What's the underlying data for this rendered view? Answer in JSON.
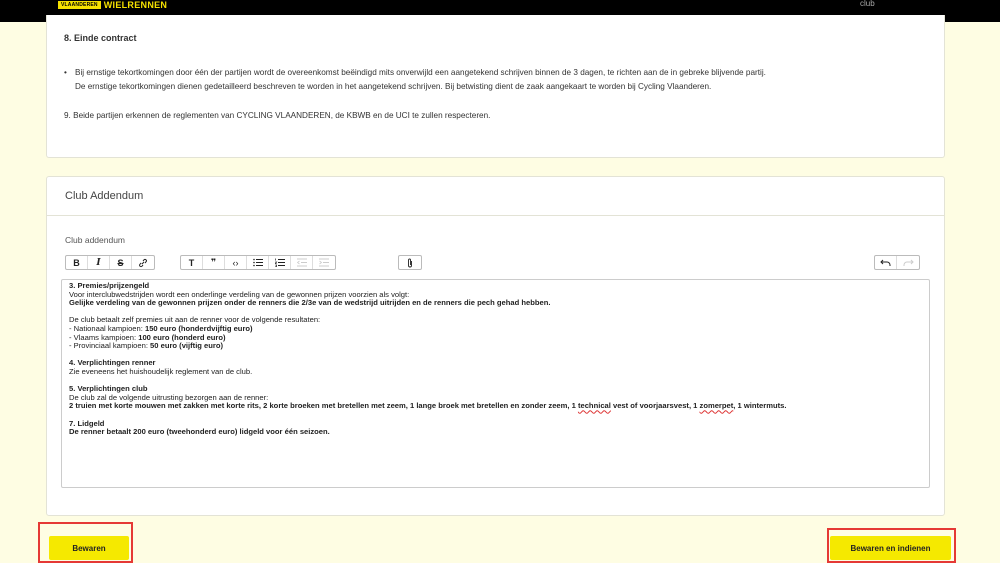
{
  "header": {
    "logo_badge": "VLAANDEREN",
    "logo_text": "WIELRENNEN",
    "club_link": "club"
  },
  "contract": {
    "section8_title": "8. Einde contract",
    "section8_bullet_line1": "Bij ernstige tekortkomingen door één der partijen wordt de overeenkomst beëindigd mits onverwijld een aangetekend schrijven binnen de 3 dagen, te richten aan de in gebreke blijvende partij.",
    "section8_bullet_line2": "De ernstige tekortkomingen dienen gedetailleerd beschreven te worden in het aangetekend schrijven. Bij betwisting dient de zaak aangekaart te worden bij Cycling Vlaanderen.",
    "section9": "9. Beide partijen erkennen de reglementen van CYCLING VLAANDEREN, de KBWB en de UCI te zullen respecteren."
  },
  "addendum": {
    "card_title": "Club Addendum",
    "field_label": "Club addendum",
    "toolbar_icons": {
      "bold": "B",
      "italic": "I",
      "strike": "S",
      "link": "🔗",
      "heading": "T",
      "quote": "❞",
      "code": "‹›",
      "bullets": "☰",
      "numbers": "☷",
      "outdent": "⇤",
      "indent": "⇥",
      "attach": "📎",
      "undo": "↶",
      "redo": "↷"
    },
    "content": {
      "h3": "3. Premies/prijzengeld",
      "p3a": "Voor interclubwedstrijden wordt een onderlinge verdeling van de gewonnen prijzen voorzien als volgt:",
      "p3b": "Gelijke verdeling van de gewonnen prijzen onder de renners die 2/3e van de wedstrijd uitrijden en de renners die pech gehad hebben.",
      "p3c": "De club betaalt zelf premies uit aan de renner voor de volgende resultaten:",
      "nat_label": "- Nationaal kampioen: ",
      "nat_value": "150 euro (honderdvijftig euro)",
      "vla_label": "- Vlaams kampioen: ",
      "vla_value": "100 euro (honderd euro)",
      "prov_label": "- Provinciaal kampioen: ",
      "prov_value": "50 euro (vijftig euro)",
      "h4": "4. Verplichtingen renner",
      "p4": "Zie eveneens het huishoudelijk reglement van de club.",
      "h5": "5. Verplichtingen club",
      "p5a": "De club zal de volgende uitrusting bezorgen aan de renner:",
      "p5b_1": "2 truien met korte mouwen met zakken met korte rits, 2 korte broeken met bretellen met zeem, 1 lange broek met bretellen en zonder zeem, 1 ",
      "p5b_technical": "technical",
      "p5b_2": " vest of voorjaarsvest, 1 ",
      "p5b_zomerpet": "zomerpet",
      "p5b_3": ", 1 wintermuts.",
      "h7": "7. Lidgeld",
      "p7": "De renner betaalt 200 euro (tweehonderd euro) lidgeld voor één seizoen."
    }
  },
  "actions": {
    "save_label": "Bewaren",
    "submit_label": "Bewaren en indienen"
  },
  "colors": {
    "page_bg": "#fefde3",
    "accent_yellow": "#f5e900",
    "highlight_red": "#e53935"
  }
}
